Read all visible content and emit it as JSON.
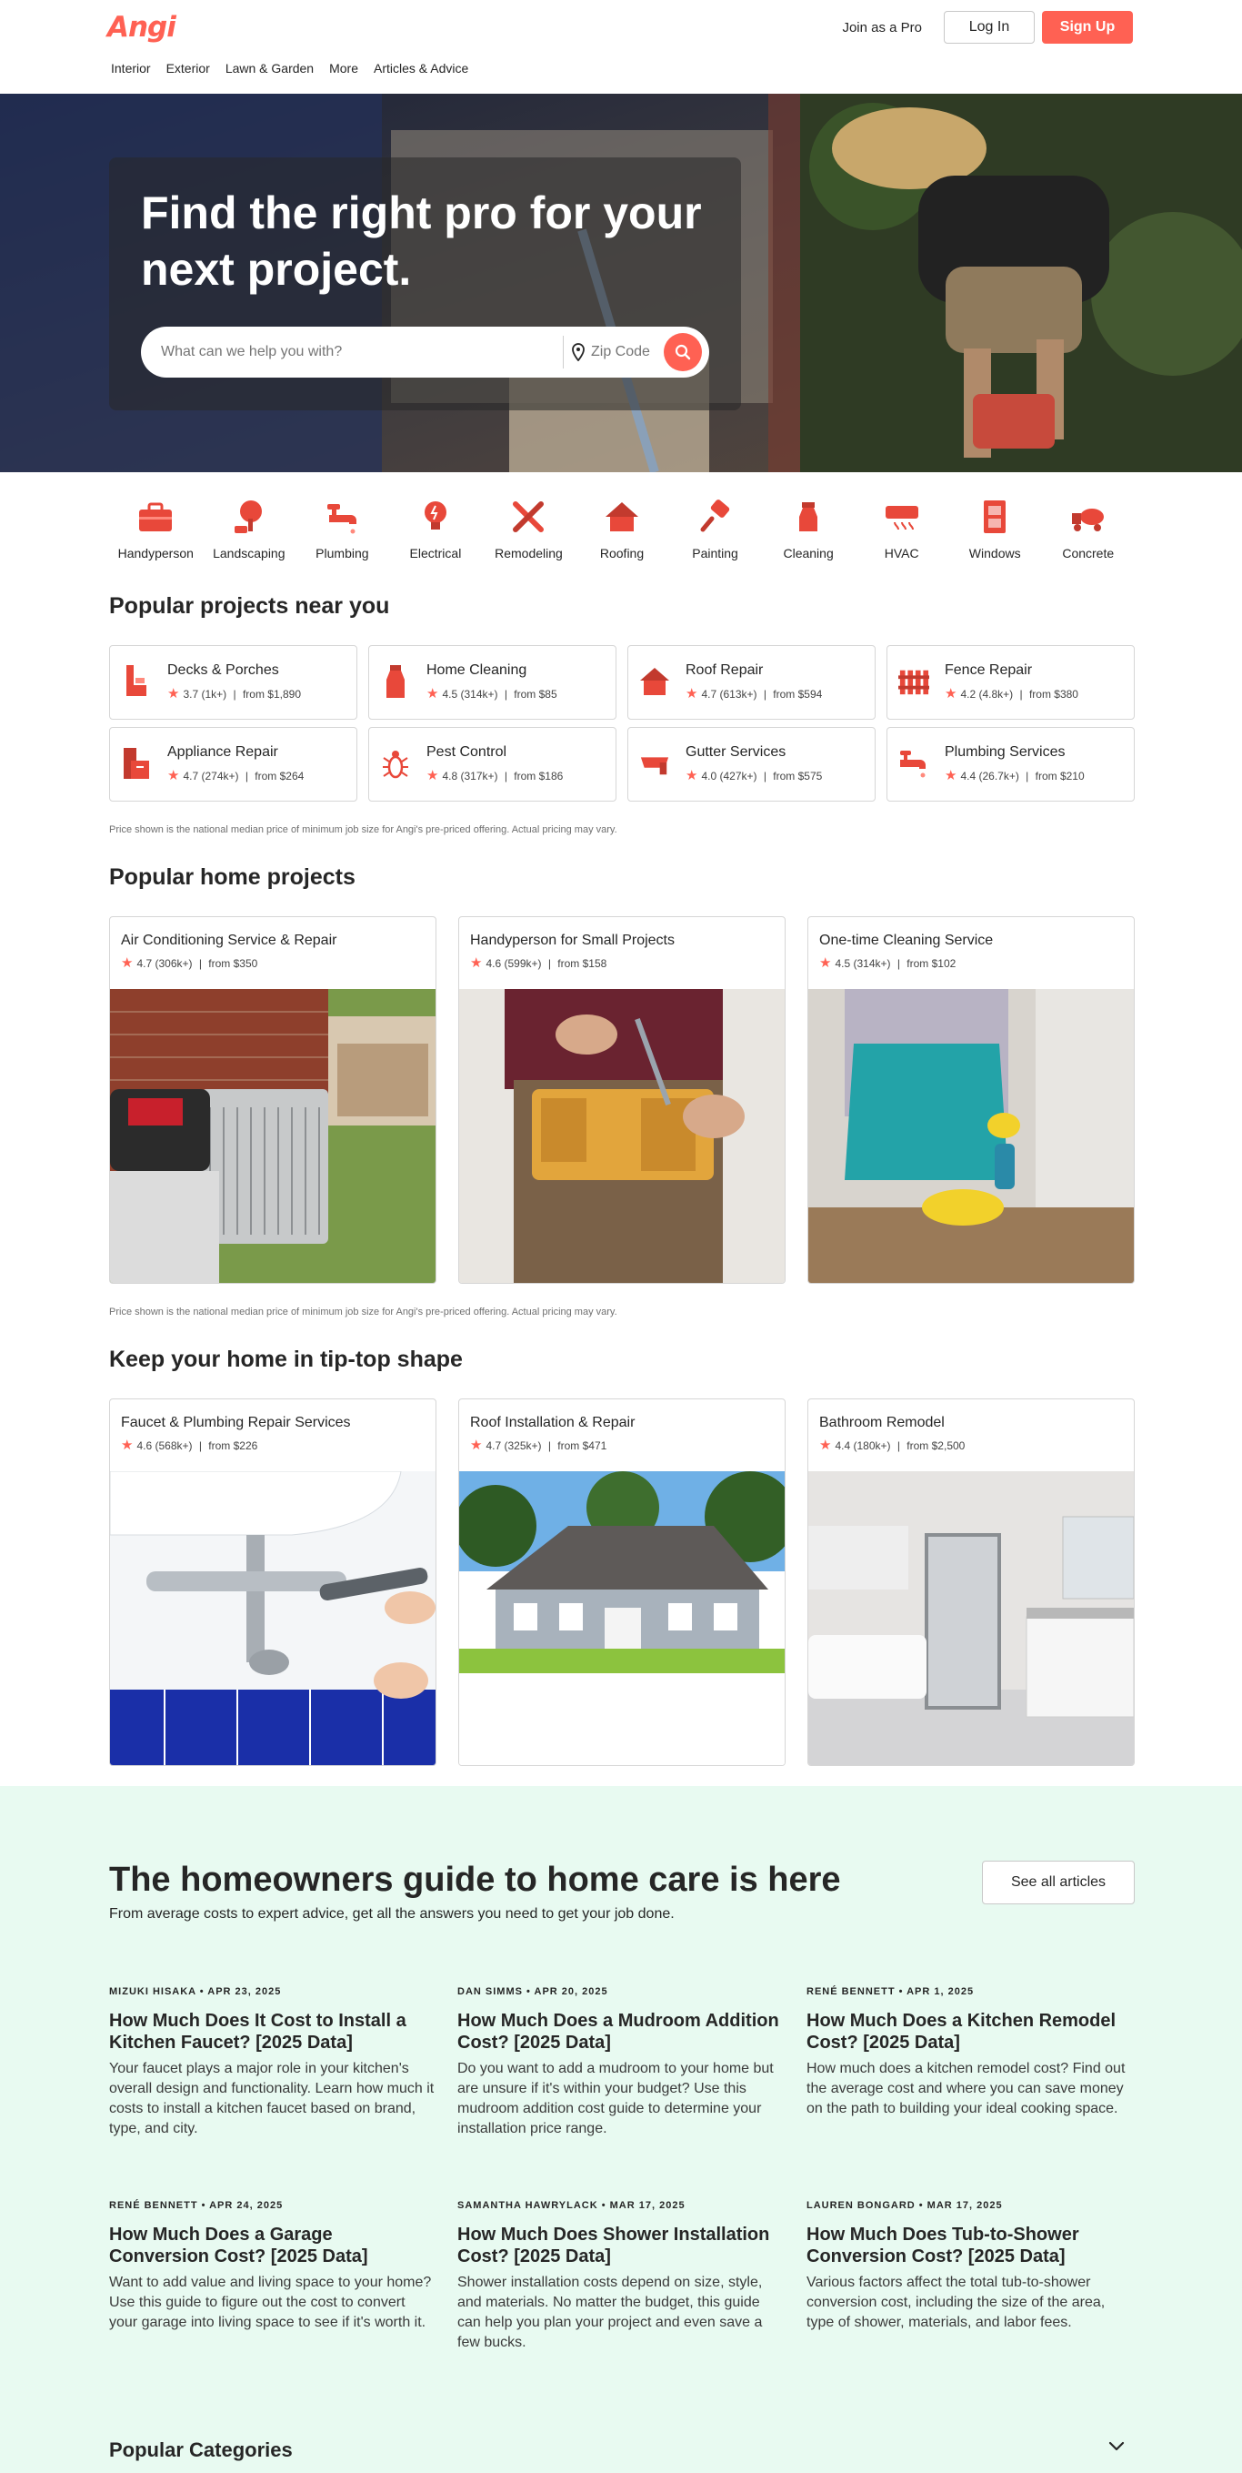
{
  "header": {
    "logo": "Angi",
    "join_pro": "Join as a Pro",
    "login": "Log In",
    "signup": "Sign Up",
    "nav": [
      "Interior",
      "Exterior",
      "Lawn & Garden",
      "More",
      "Articles & Advice"
    ]
  },
  "hero": {
    "title": "Find the right pro for your next project.",
    "search_placeholder": "What can we help you with?",
    "zip_placeholder": "Zip Code"
  },
  "categories": [
    "Handyperson",
    "Landscaping",
    "Plumbing",
    "Electrical",
    "Remodeling",
    "Roofing",
    "Painting",
    "Cleaning",
    "HVAC",
    "Windows",
    "Concrete"
  ],
  "popular_near": {
    "heading": "Popular projects near you",
    "items": [
      {
        "title": "Decks & Porches",
        "rating": "3.7 (1k+)",
        "price": "from $1,890",
        "icon": "deck-icon"
      },
      {
        "title": "Home Cleaning",
        "rating": "4.5 (314k+)",
        "price": "from $85",
        "icon": "spray-bottle-icon"
      },
      {
        "title": "Roof Repair",
        "rating": "4.7 (613k+)",
        "price": "from $594",
        "icon": "roof-icon"
      },
      {
        "title": "Fence Repair",
        "rating": "4.2 (4.8k+)",
        "price": "from $380",
        "icon": "fence-icon"
      },
      {
        "title": "Appliance Repair",
        "rating": "4.7 (274k+)",
        "price": "from $264",
        "icon": "appliance-icon"
      },
      {
        "title": "Pest Control",
        "rating": "4.8 (317k+)",
        "price": "from $186",
        "icon": "bug-icon"
      },
      {
        "title": "Gutter Services",
        "rating": "4.0 (427k+)",
        "price": "from $575",
        "icon": "gutter-icon"
      },
      {
        "title": "Plumbing Services",
        "rating": "4.4 (26.7k+)",
        "price": "from $210",
        "icon": "faucet-icon"
      }
    ],
    "disclaimer": "Price shown is the national median price of minimum job size for Angi's pre-priced offering. Actual pricing may vary."
  },
  "popular_home": {
    "heading": "Popular home projects",
    "items": [
      {
        "title": "Air Conditioning Service & Repair",
        "rating": "4.7 (306k+)",
        "price": "from $350"
      },
      {
        "title": "Handyperson for Small Projects",
        "rating": "4.6 (599k+)",
        "price": "from $158"
      },
      {
        "title": "One-time Cleaning Service",
        "rating": "4.5 (314k+)",
        "price": "from $102"
      }
    ],
    "disclaimer": "Price shown is the national median price of minimum job size for Angi's pre-priced offering. Actual pricing may vary."
  },
  "tiptop": {
    "heading": "Keep your home in tip-top shape",
    "items": [
      {
        "title": "Faucet & Plumbing Repair Services",
        "rating": "4.6 (568k+)",
        "price": "from $226"
      },
      {
        "title": "Roof Installation & Repair",
        "rating": "4.7 (325k+)",
        "price": "from $471"
      },
      {
        "title": "Bathroom Remodel",
        "rating": "4.4 (180k+)",
        "price": "from $2,500"
      }
    ]
  },
  "guide": {
    "title": "The homeowners guide to home care is here",
    "subtitle": "From average costs to expert advice, get all the answers you need to get your job done.",
    "see_all": "See all articles",
    "articles": [
      {
        "meta": "Mizuki Hisaka • Apr 23, 2025",
        "title": "How Much Does It Cost to Install a Kitchen Faucet? [2025 Data]",
        "desc": "Your faucet plays a major role in your kitchen's overall design and functionality. Learn how much it costs to install a kitchen faucet based on brand, type, and city."
      },
      {
        "meta": "Dan Simms • Apr 20, 2025",
        "title": "How Much Does a Mudroom Addition Cost? [2025 Data]",
        "desc": "Do you want to add a mudroom to your home but are unsure if it's within your budget? Use this mudroom addition cost guide to determine your installation price range."
      },
      {
        "meta": "René Bennett • Apr 1, 2025",
        "title": "How Much Does a Kitchen Remodel Cost? [2025 Data]",
        "desc": "How much does a kitchen remodel cost? Find out the average cost and where you can save money on the path to building your ideal cooking space."
      },
      {
        "meta": "René Bennett • Apr 24, 2025",
        "title": "How Much Does a Garage Conversion Cost? [2025 Data]",
        "desc": "Want to add value and living space to your home? Use this guide to figure out the cost to convert your garage into living space to see if it's worth it."
      },
      {
        "meta": "Samantha Hawrylack • Mar 17, 2025",
        "title": "How Much Does Shower Installation Cost? [2025 Data]",
        "desc": "Shower installation costs depend on size, style, and materials. No matter the budget, this guide can help you plan your project and even save a few bucks."
      },
      {
        "meta": "Lauren Bongard • Mar 17, 2025",
        "title": "How Much Does Tub-to-Shower Conversion Cost? [2025 Data]",
        "desc": "Various factors affect the total tub-to-shower conversion cost, including the size of the area, type of shower, materials, and labor fees."
      }
    ]
  },
  "popular_categories": "Popular Categories",
  "colors": {
    "brand": "#ff6153",
    "guide_bg": "#e8faf1",
    "text": "#262626"
  }
}
